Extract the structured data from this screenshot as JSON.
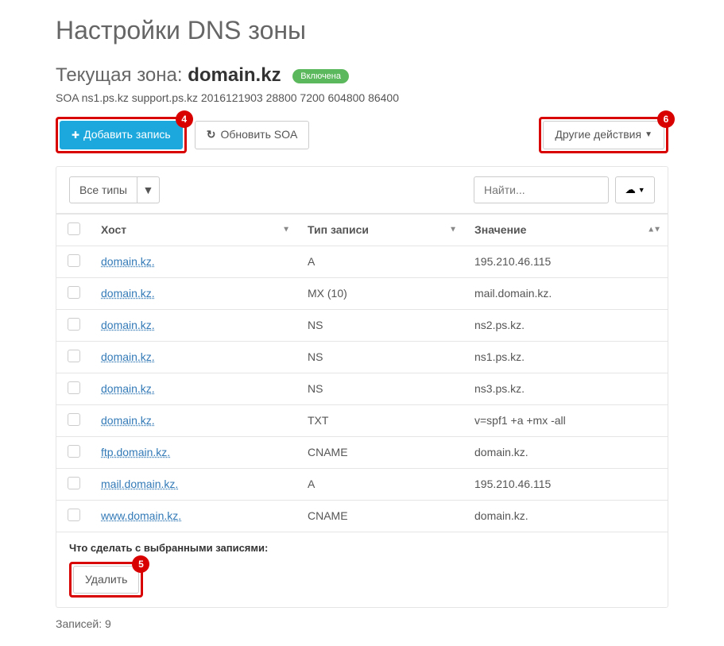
{
  "page_title": "Настройки DNS зоны",
  "zone": {
    "prefix": "Текущая зона: ",
    "domain": "domain.kz",
    "status_label": "Включена"
  },
  "soa_line": "SOA ns1.ps.kz support.ps.kz 2016121903 28800 7200 604800 86400",
  "toolbar": {
    "add_record": "Добавить запись",
    "refresh_soa": "Обновить SOA",
    "other_actions": "Другие действия"
  },
  "badges": {
    "add": "4",
    "other": "6",
    "delete": "5"
  },
  "filter": {
    "all_types": "Все типы",
    "search_placeholder": "Найти..."
  },
  "table": {
    "headers": {
      "host": "Хост",
      "type": "Тип записи",
      "value": "Значение"
    },
    "rows": [
      {
        "host": "domain.kz.",
        "type": "A",
        "value": "195.210.46.115"
      },
      {
        "host": "domain.kz.",
        "type": "MX (10)",
        "value": "mail.domain.kz."
      },
      {
        "host": "domain.kz.",
        "type": "NS",
        "value": "ns2.ps.kz."
      },
      {
        "host": "domain.kz.",
        "type": "NS",
        "value": "ns1.ps.kz."
      },
      {
        "host": "domain.kz.",
        "type": "NS",
        "value": "ns3.ps.kz."
      },
      {
        "host": "domain.kz.",
        "type": "TXT",
        "value": "v=spf1 +a +mx -all"
      },
      {
        "host": "ftp.domain.kz.",
        "type": "CNAME",
        "value": "domain.kz."
      },
      {
        "host": "mail.domain.kz.",
        "type": "A",
        "value": "195.210.46.115"
      },
      {
        "host": "www.domain.kz.",
        "type": "CNAME",
        "value": "domain.kz."
      }
    ]
  },
  "bulk": {
    "label": "Что сделать с выбранными записями:",
    "delete": "Удалить"
  },
  "footer_count": "Записей: 9"
}
